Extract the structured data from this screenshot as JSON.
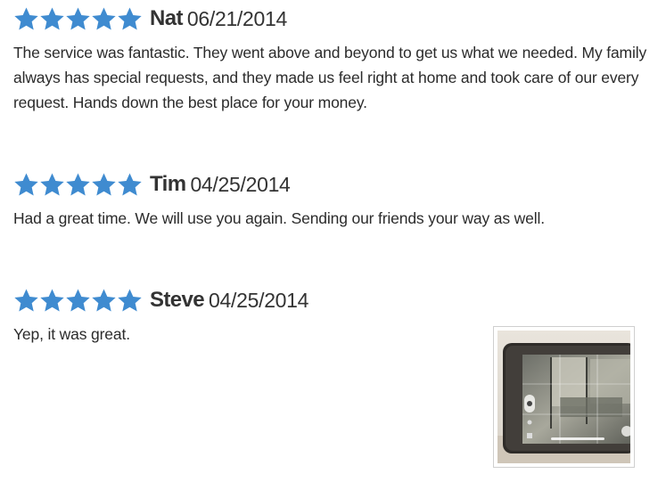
{
  "colors": {
    "star": "#3f8bd0",
    "text": "#2b2b2b",
    "name": "#333333"
  },
  "reviews": [
    {
      "rating": 5,
      "name": "Nat",
      "date": "06/21/2014",
      "text": "The service was fantastic. They went above and beyond to get us what we needed. My family always has special requests, and they made us feel right at home and took care of our every request. Hands down the best place for your money."
    },
    {
      "rating": 5,
      "name": "Tim",
      "date": "04/25/2014",
      "text": "Had a great time. We will use you again. Sending our friends your way as well."
    },
    {
      "rating": 5,
      "name": "Steve",
      "date": "04/25/2014",
      "text": "Yep, it was great."
    }
  ],
  "photo": {
    "icon": "tablet-camera-photo"
  }
}
